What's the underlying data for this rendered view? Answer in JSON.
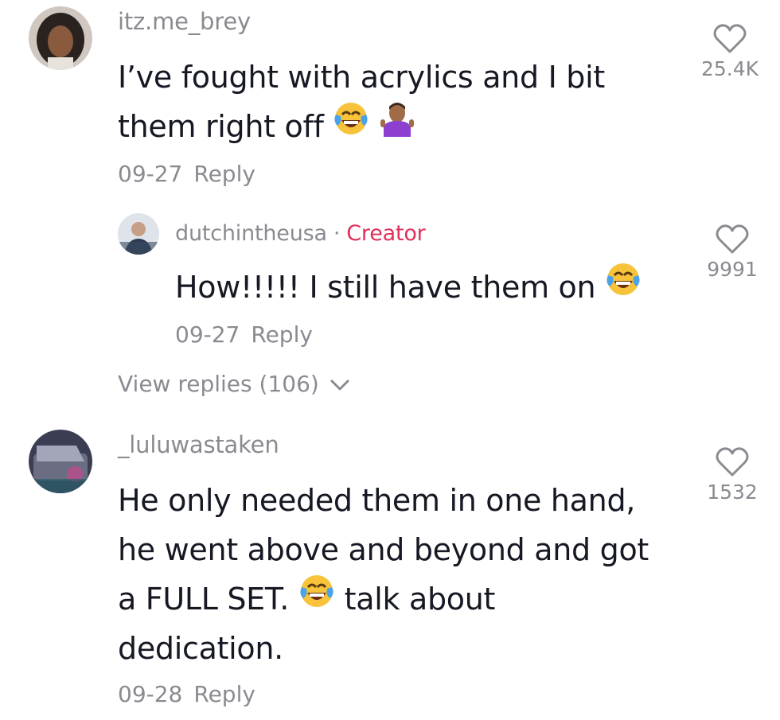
{
  "comments": [
    {
      "username": "itz.me_brey",
      "text_line1": "I’ve fought with acrylics and I bit",
      "text_line2": "them right off",
      "emoji": [
        "face-with-tears-of-joy",
        "person-shrugging"
      ],
      "date": "09-27",
      "reply_label": "Reply",
      "like_count": "25.4K"
    },
    {
      "username": "dutchintheusa",
      "creator_label": "Creator",
      "text": "How!!!!! I still have them on",
      "emoji": [
        "face-with-tears-of-joy"
      ],
      "date": "09-27",
      "reply_label": "Reply",
      "like_count": "9991"
    },
    {
      "username": "_luluwastaken",
      "text_line1": "He only needed them in one hand,",
      "text_line2": "he went above and beyond and got",
      "text_line3a": "a FULL SET.",
      "text_line3b": "talk about",
      "text_line4": "dedication.",
      "emoji": [
        "face-with-tears-of-joy"
      ],
      "date": "09-28",
      "reply_label": "Reply",
      "like_count": "1532"
    }
  ],
  "view_replies_label": "View replies (106)",
  "colors": {
    "text": "#161823",
    "muted": "#8a8b91",
    "creator": "#e1305c"
  }
}
